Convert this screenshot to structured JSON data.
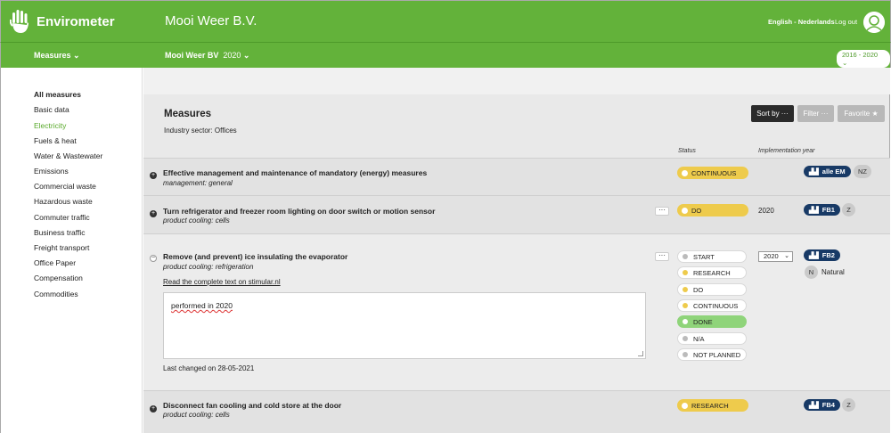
{
  "app": {
    "name": "Envirometer",
    "company": "Mooi Weer B.V."
  },
  "header": {
    "lang_en": "English",
    "lang_sep": " - ",
    "lang_nl": "Nederlands",
    "logout": "Log out"
  },
  "subnav": {
    "measures": "Measures",
    "org_label": "Mooi Weer BV",
    "year": "2020",
    "range": "2016 - 2020"
  },
  "sidebar": {
    "items": [
      {
        "label": "All measures"
      },
      {
        "label": "Basic data"
      },
      {
        "label": "Electricity"
      },
      {
        "label": "Fuels & heat"
      },
      {
        "label": "Water & Wastewater"
      },
      {
        "label": "Emissions"
      },
      {
        "label": "Commercial waste"
      },
      {
        "label": "Hazardous waste"
      },
      {
        "label": "Commuter traffic"
      },
      {
        "label": "Business traffic"
      },
      {
        "label": "Freight transport"
      },
      {
        "label": "Office Paper"
      },
      {
        "label": "Compensation"
      },
      {
        "label": "Commodities"
      }
    ]
  },
  "main": {
    "title": "Measures",
    "sector": "Industry sector: Offices",
    "sort": "Sort by ···",
    "filter": "Filter ···",
    "favorite": "Favorite",
    "col_status": "Status",
    "col_year": "Implementation year"
  },
  "rows": [
    {
      "title": "Effective management and maintenance of mandatory (energy) measures",
      "sub": "management: general",
      "status": "CONTINUOUS",
      "year": "",
      "tag": "alle EM",
      "chip": "NZ"
    },
    {
      "title": "Turn refrigerator and freezer room lighting on door switch or motion sensor",
      "sub": "product cooling: cells",
      "status": "DO",
      "year": "2020",
      "tag": "FB1",
      "chip": "Z"
    },
    {
      "title": "Remove (and prevent) ice insulating the evaporator",
      "sub": "product cooling: refrigeration",
      "year": "2020",
      "tag": "FB2",
      "chip": "N",
      "chip_label": "Natural",
      "link": "Read the complete text on stimular.nl",
      "note": "performed in 2020",
      "last_changed": "Last changed on 28-05-2021",
      "options": [
        "START",
        "RESEARCH",
        "DO",
        "CONTINUOUS",
        "DONE",
        "N/A",
        "NOT PLANNED"
      ]
    },
    {
      "title": "Disconnect fan cooling and cold store at the door",
      "sub": "product cooling: cells",
      "status": "RESEARCH",
      "year": "",
      "tag": "FB4",
      "chip": "Z"
    }
  ],
  "colors": {
    "brand_green": "#63b23a",
    "status_yellow": "#eecb4c",
    "done_green": "#8fd47a",
    "tag_navy": "#183a66"
  }
}
